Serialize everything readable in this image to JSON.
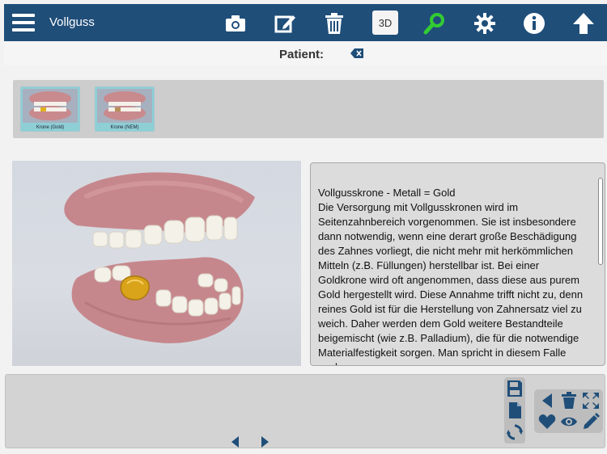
{
  "header": {
    "title": "Vollguss",
    "btn_3d_label": "3D",
    "icons": [
      "menu-icon",
      "camera-icon",
      "edit-icon",
      "trash-icon",
      "search-icon",
      "gear-icon",
      "info-icon",
      "upload-arrow-icon"
    ],
    "accent_color": "#1f4e79",
    "search_color": "#33cc33"
  },
  "patient": {
    "label": "Patient:",
    "clear_icon": "backspace-clear-icon"
  },
  "thumbnails": [
    {
      "caption": "Krone (Gold)"
    },
    {
      "caption": "Krone (NEM)"
    }
  ],
  "text_panel": {
    "heading": "Vollgusskrone - Metall = Gold",
    "body": "Die Versorgung mit Vollgusskronen wird im Seitenzahnbereich vorgenommen. Sie ist insbesondere dann notwendig, wenn eine derart große Beschädigung des Zahnes vorliegt, die nicht mehr mit herkömmlichen Mitteln (z.B. Füllungen) herstellbar ist. Bei einer Goldkrone wird oft angenommen, dass diese aus purem Gold hergestellt wird. Diese Annahme trifft nicht zu, denn reines Gold ist für die Herstellung von Zahnersatz viel zu weich. Daher werden dem Gold weitere Bestandteile beigemischt (wie z.B. Palladium), die für die notwendige Materialfestigkeit sorgen. Man spricht in diesem Falle auch"
  },
  "bottom": {
    "nav_icons": [
      "chevron-left-icon",
      "chevron-right-icon"
    ],
    "side_tools": [
      "save-icon",
      "document-icon",
      "refresh-icon"
    ],
    "actions": [
      "back-icon",
      "trash-icon",
      "expand-icon",
      "heart-icon",
      "eye-icon",
      "pencil-icon"
    ]
  }
}
